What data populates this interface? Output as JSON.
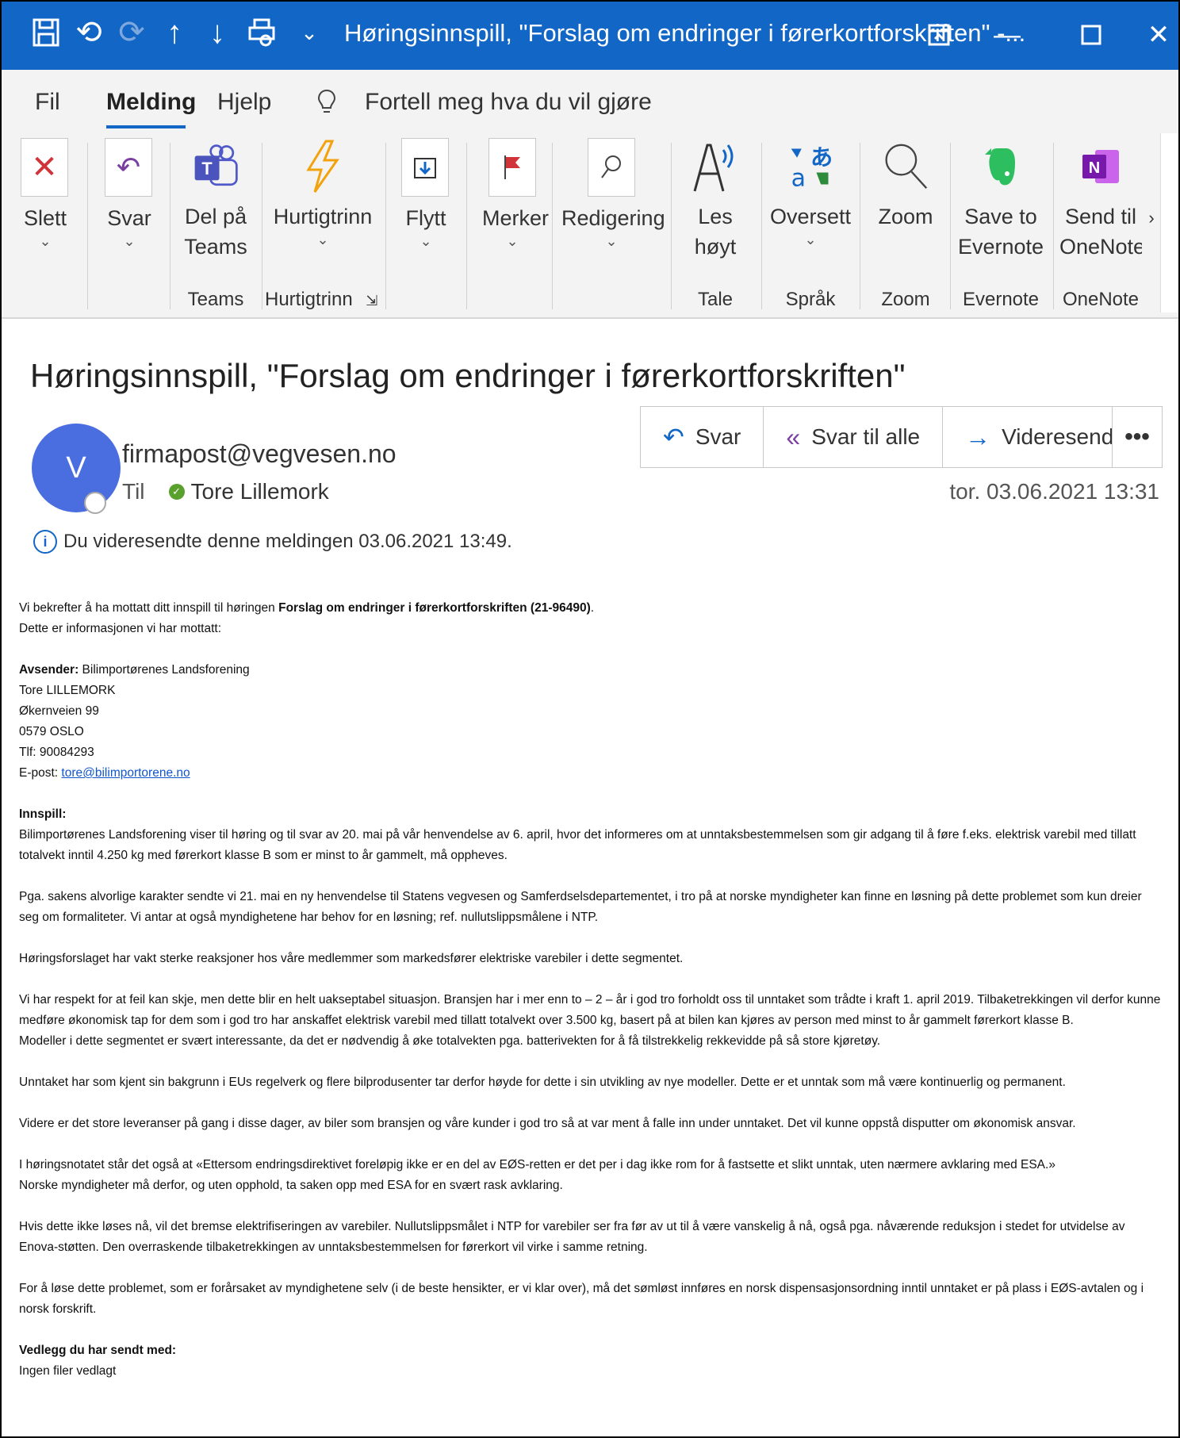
{
  "window": {
    "title": "Høringsinnspill, \"Forslag om endringer i førerkortforskriften\"  -...",
    "quick_access": [
      "save-icon",
      "undo-icon",
      "redo-icon",
      "up-icon",
      "down-icon",
      "print-icon",
      "customize-icon"
    ],
    "accent": "#1266c6"
  },
  "menu": {
    "fil": "Fil",
    "melding": "Melding",
    "hjelp": "Hjelp",
    "tell_me": "Fortell meg hva du vil gjøre"
  },
  "ribbon": {
    "slett": "Slett",
    "svar": "Svar",
    "del_pa": "Del på",
    "teams": "Teams",
    "hurtigtrinn": "Hurtigtrinn",
    "flytt": "Flytt",
    "merker": "Merker",
    "redigering": "Redigering",
    "les": "Les",
    "hoyt": "høyt",
    "oversett": "Oversett",
    "zoom": "Zoom",
    "save_to": "Save to",
    "evernote": "Evernote",
    "send_til": "Send til",
    "onenote": "OneNote",
    "groups": {
      "teams": "Teams",
      "hurtigtrinn": "Hurtigtrinn",
      "tale": "Tale",
      "sprak": "Språk",
      "zoom": "Zoom",
      "evernote": "Evernote",
      "onenote": "OneNote"
    }
  },
  "message": {
    "subject": "Høringsinnspill, \"Forslag om endringer i førerkortforskriften\"",
    "avatar_letter": "V",
    "from": "firmapost@vegvesen.no",
    "to_label": "Til",
    "to_name": "Tore Lillemork",
    "date": "tor. 03.06.2021 13:31",
    "actions": {
      "reply": "Svar",
      "reply_all": "Svar til alle",
      "forward": "Videresend",
      "more": "•••"
    },
    "info": "Du videresendte denne meldingen 03.06.2021 13:49."
  },
  "body": {
    "intro_a": "Vi bekrefter å ha mottatt ditt innspill til høringen ",
    "intro_b": "Forslag om endringer i førerkortforskriften (21-96490)",
    "intro_c": ".",
    "intro2": "Dette er informasjonen vi har mottatt:",
    "avsender_label": "Avsender:",
    "avsender_org": " Bilimportørenes Landsforening",
    "name": "Tore LILLEMORK",
    "street": "Økernveien 99",
    "city": "0579 OSLO",
    "phone": "Tlf: 90084293",
    "email_label": "E-post: ",
    "email": "tore@bilimportorene.no",
    "innspill_label": "Innspill:",
    "p1": "Bilimportørenes Landsforening viser til høring og til svar av 20. mai på vår henvendelse av 6. april, hvor det informeres om at unntaksbestemmelsen som gir adgang til å føre f.eks. elektrisk varebil med tillatt totalvekt inntil 4.250 kg med førerkort klasse B som er minst to år gammelt, må oppheves.",
    "p2": "Pga. sakens alvorlige karakter sendte vi 21. mai en ny henvendelse til Statens vegvesen og Samferdselsdepartementet, i tro på at norske myndigheter kan finne en løsning på dette problemet som kun dreier seg om formaliteter. Vi antar at også myndighetene har behov for en løsning; ref. nullutslippsmålene i NTP.",
    "p3": "Høringsforslaget har vakt sterke reaksjoner hos våre medlemmer som markedsfører elektriske varebiler i dette segmentet.",
    "p4a": "Vi har respekt for at feil kan skje, men dette blir en helt uakseptabel situasjon. Bransjen har i mer enn to – 2 – år i god tro forholdt oss til unntaket som trådte i kraft 1. april 2019. Tilbaketrekkingen vil derfor kunne medføre økonomisk tap for dem som i god tro har anskaffet elektrisk varebil med tillatt totalvekt over 3.500 kg, basert på at bilen kan kjøres av person med minst to år gammelt førerkort klasse B.",
    "p4b": "Modeller i dette segmentet er svært interessante, da det er nødvendig å øke totalvekten pga. batterivekten for å få tilstrekkelig rekkevidde på så store kjøretøy.",
    "p5": "Unntaket har som kjent sin bakgrunn i EUs regelverk og flere bilprodusenter tar derfor høyde for dette i sin utvikling av nye modeller. Dette er et unntak som må være kontinuerlig og permanent.",
    "p6": "Videre er det store leveranser på gang i disse dager, av biler som bransjen og våre kunder i god tro så at var ment å falle inn under unntaket. Det vil kunne oppstå disputter om økonomisk ansvar.",
    "p7a": "I høringsnotatet står det også at «Ettersom endringsdirektivet foreløpig ikke er en del av EØS-retten er det per i dag ikke rom for å fastsette et slikt unntak, uten nærmere avklaring med ESA.»",
    "p7b": "Norske myndigheter må derfor, og uten opphold, ta saken opp med ESA for en svært rask avklaring.",
    "p8": "Hvis dette ikke løses nå, vil det bremse elektrifiseringen av varebiler. Nullutslippsmålet i NTP for varebiler ser fra før av ut til å være vanskelig å nå, også pga. nåværende reduksjon i stedet for utvidelse av Enova-støtten. Den overraskende tilbaketrekkingen av unntaksbestemmelsen for førerkort vil virke i samme retning.",
    "p9": "For å løse dette problemet, som er forårsaket av myndighetene selv (i de beste hensikter, er vi klar over), må det sømløst innføres en norsk dispensasjonsordning inntil unntaket er på plass i EØS-avtalen og i norsk forskrift.",
    "vedlegg_label": "Vedlegg du har sendt med:",
    "vedlegg": "Ingen filer vedlagt"
  }
}
